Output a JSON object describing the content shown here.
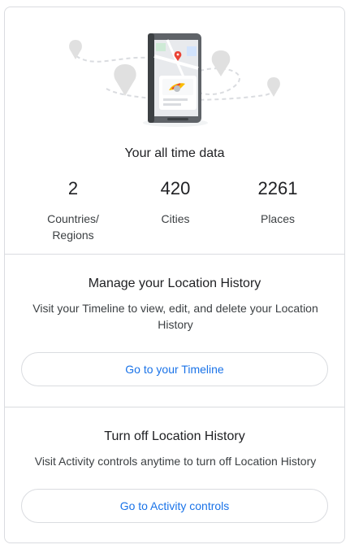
{
  "all_time": {
    "title": "Your all time data",
    "stats": [
      {
        "value": "2",
        "label_line1": "Countries/",
        "label_line2": "Regions"
      },
      {
        "value": "420",
        "label_line1": "Cities",
        "label_line2": ""
      },
      {
        "value": "2261",
        "label_line1": "Places",
        "label_line2": ""
      }
    ]
  },
  "manage": {
    "title": "Manage your Location History",
    "description_line1": "Visit your Timeline to view, edit, and delete your Location",
    "description_line2": "History",
    "button_label": "Go to your Timeline"
  },
  "turn_off": {
    "title": "Turn off Location History",
    "description": "Visit Activity controls anytime to turn off Location History",
    "button_label": "Go to Activity controls"
  },
  "colors": {
    "accent": "#1a73e8",
    "border": "#dadce0",
    "text": "#202124",
    "secondary_text": "#3c4043",
    "pin_red": "#ea4335"
  },
  "icons": {
    "illustration": "phone-map-illustration-icon"
  }
}
